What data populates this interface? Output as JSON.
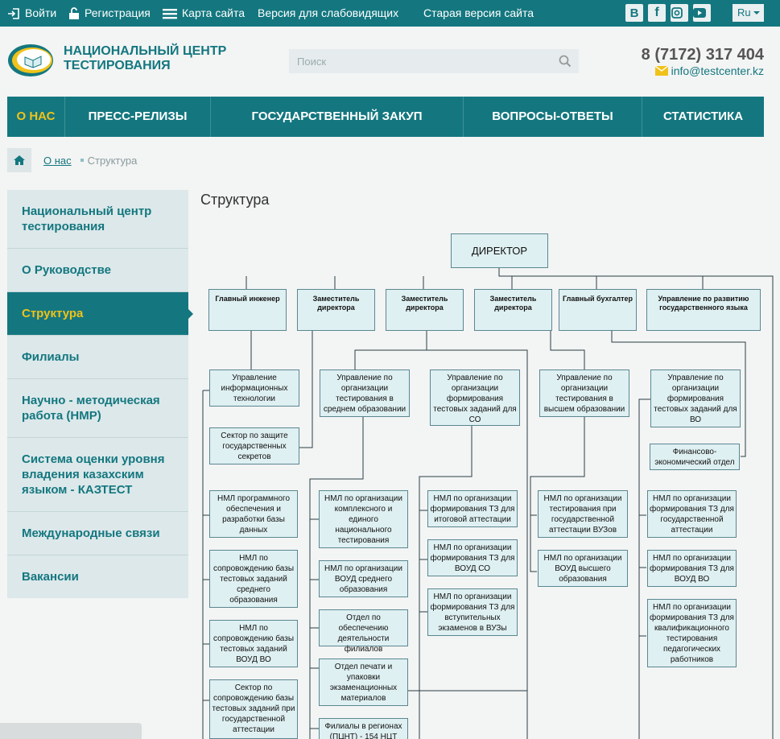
{
  "topbar": {
    "login": "Войти",
    "register": "Регистрация",
    "sitemap": "Карта сайта",
    "vision": "Версия для слабовидящих",
    "old": "Старая версия сайта",
    "lang": "Ru"
  },
  "social": [
    "vk-icon",
    "facebook-icon",
    "instagram-icon",
    "youtube-icon"
  ],
  "brand": {
    "line1": "НАЦИОНАЛЬНЫЙ ЦЕНТР",
    "line2": "ТЕСТИРОВАНИЯ"
  },
  "search": {
    "placeholder": "Поиск"
  },
  "contact": {
    "phone": "8 (7172) 317 404",
    "email": "info@testcenter.kz"
  },
  "nav": [
    {
      "label": "О НАС"
    },
    {
      "label": "ПРЕСС-РЕЛИЗЫ"
    },
    {
      "label": "ГОСУДАРСТВЕННЫЙ ЗАКУП"
    },
    {
      "label": "ВОПРОСЫ-ОТВЕТЫ"
    },
    {
      "label": "СТАТИСТИКА"
    }
  ],
  "breadcrumb": {
    "parent": "О нас",
    "current": "Структура"
  },
  "sidebar": [
    {
      "label": "Национальный центр тестирования"
    },
    {
      "label": "О Руководстве"
    },
    {
      "label": "Структура"
    },
    {
      "label": "Филиалы"
    },
    {
      "label": "Научно - методическая работа (НМР)"
    },
    {
      "label": "Система оценки уровня владения казахским языком - КАЗТЕСТ"
    },
    {
      "label": "Международные связи"
    },
    {
      "label": "Вакансии"
    }
  ],
  "page_title": "Структура",
  "org": {
    "director": "ДИРЕКТОР",
    "top": [
      "Главный инженер",
      "Заместитель директора",
      "Заместитель директора",
      "Заместитель директора",
      "Главный бухгалтер",
      "Управление по развитию государственного языка"
    ],
    "units": [
      "Управление информационных технологии",
      "Сектор по защите государственных секретов",
      "НМЛ программного обеспечения и разработки базы данных",
      "НМЛ по сопровождению базы тестовых заданий среднего образования",
      "НМЛ по сопровождению базы тестовых заданий ВОУД ВО",
      "Сектор по сопровождению базы тестовых заданий при государственной аттестации",
      "Управление по организации тестирования в среднем образовании",
      "НМЛ по организации комплексного и единого национального тестирования",
      "НМЛ по организации ВОУД среднего образования",
      "Отдел по обеспечению деятельности филиалов",
      "Отдел печати и упаковки экзаменационных материалов",
      "Филиалы в регионах (ПЦНТ) - 154 НЦТ",
      "Управление по организации формирования тестовых заданий для СО",
      "НМЛ по организации формирования ТЗ для итоговой аттестации",
      "НМЛ по организации формирования ТЗ для ВОУД СО",
      "НМЛ по организации формирования ТЗ для вступительных экзаменов в ВУЗы",
      "Управление по организации тестирования в высшем образовании",
      "НМЛ по организации тестирования при государственной аттестации ВУЗов",
      "НМЛ по организации ВОУД высшего образования",
      "Управление по организации формирования тестовых заданий для ВО",
      "Финансово-экономический отдел",
      "НМЛ по организации формирования ТЗ для государственной аттестации",
      "НМЛ по организации формирования ТЗ для ВОУД ВО",
      "НМЛ по организации формирования ТЗ для квалификационного тестирования педагогических работников"
    ]
  },
  "colors": {
    "primary": "#14777f",
    "accent": "#f0c21a",
    "box": "#dff0f2"
  }
}
